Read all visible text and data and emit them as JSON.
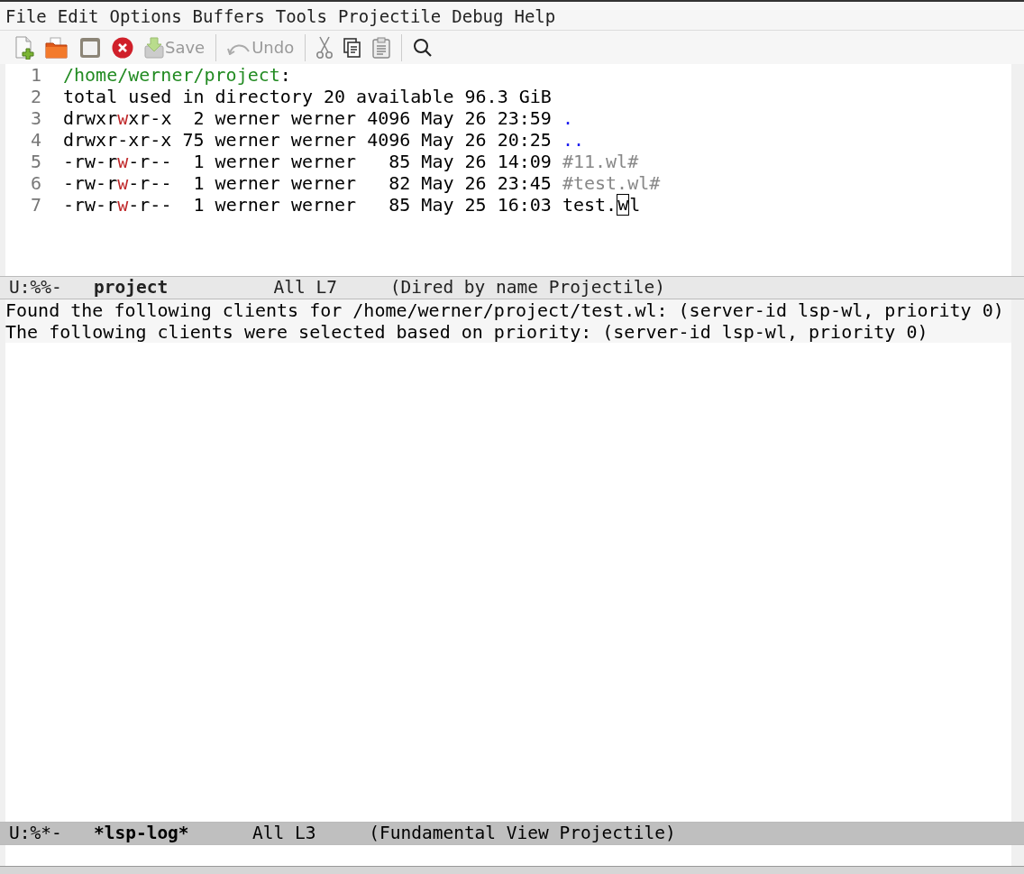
{
  "menu_bar": [
    "File",
    "Edit",
    "Options",
    "Buffers",
    "Tools",
    "Projectile",
    "Debug",
    "Help"
  ],
  "toolbar": [
    {
      "kind": "icon",
      "disabled": false
    },
    {
      "kind": "icon",
      "disabled": false
    },
    {
      "kind": "icon",
      "disabled": false
    },
    {
      "kind": "icon",
      "disabled": false
    },
    {
      "kind": "labeled",
      "label": "Save",
      "disabled": true
    },
    {
      "kind": "separator"
    },
    {
      "kind": "labeled",
      "label": "Undo",
      "disabled": true
    },
    {
      "kind": "separator"
    },
    {
      "kind": "icon",
      "disabled": false
    },
    {
      "kind": "icon",
      "disabled": false
    },
    {
      "kind": "icon",
      "disabled": false
    },
    {
      "kind": "separator"
    },
    {
      "kind": "icon",
      "disabled": false
    }
  ],
  "dired_window": {
    "lines": [
      {
        "number": "1",
        "segments": [
          {
            "kind": "header",
            "text": "/home/werner/project"
          },
          {
            "kind": "plain",
            "text": ":"
          }
        ]
      },
      {
        "number": "2",
        "segments": [
          {
            "kind": "plain",
            "text": "total used in directory 20 available 96.3 GiB"
          }
        ]
      },
      {
        "number": "3",
        "segments": [
          {
            "kind": "plain",
            "text": "drwxr"
          },
          {
            "kind": "write",
            "text": "w"
          },
          {
            "kind": "plain",
            "text": "xr-x  2 werner werner 4096 May 26 23:59 "
          },
          {
            "kind": "directory",
            "text": "."
          }
        ]
      },
      {
        "number": "4",
        "segments": [
          {
            "kind": "plain",
            "text": "drwxr-xr-x 75 werner werner 4096 May 26 20:25 "
          },
          {
            "kind": "directory",
            "text": ".."
          }
        ]
      },
      {
        "number": "5",
        "segments": [
          {
            "kind": "plain",
            "text": "-rw-r"
          },
          {
            "kind": "write",
            "text": "w"
          },
          {
            "kind": "plain",
            "text": "-r--  1 werner werner   85 May 26 14:09 "
          },
          {
            "kind": "ignored",
            "text": "#11.wl#"
          }
        ]
      },
      {
        "number": "6",
        "segments": [
          {
            "kind": "plain",
            "text": "-rw-r"
          },
          {
            "kind": "write",
            "text": "w"
          },
          {
            "kind": "plain",
            "text": "-r--  1 werner werner   82 May 26 23:45 "
          },
          {
            "kind": "ignored",
            "text": "#test.wl#"
          }
        ]
      },
      {
        "number": "7",
        "segments": [
          {
            "kind": "plain",
            "text": "-rw-r"
          },
          {
            "kind": "write",
            "text": "w"
          },
          {
            "kind": "plain",
            "text": "-r--  1 werner werner   85 May 25 16:03 test."
          },
          {
            "kind": "cursor",
            "text": "w"
          },
          {
            "kind": "plain",
            "text": "l"
          }
        ]
      }
    ],
    "mode_line": {
      "active": false,
      "status": "U:%%-",
      "buffer": "project",
      "position": "All L7",
      "modes": "(Dired by name Projectile)"
    }
  },
  "log_window": {
    "lines": [
      "Found the following clients for /home/werner/project/test.wl: (server-id lsp-wl, priority 0)",
      "The following clients were selected based on priority: (server-id lsp-wl, priority 0)"
    ],
    "mode_line": {
      "active": true,
      "status": "U:%*-",
      "buffer": "*lsp-log*",
      "position": "All L3",
      "modes": "(Fundamental View Projectile)"
    }
  }
}
